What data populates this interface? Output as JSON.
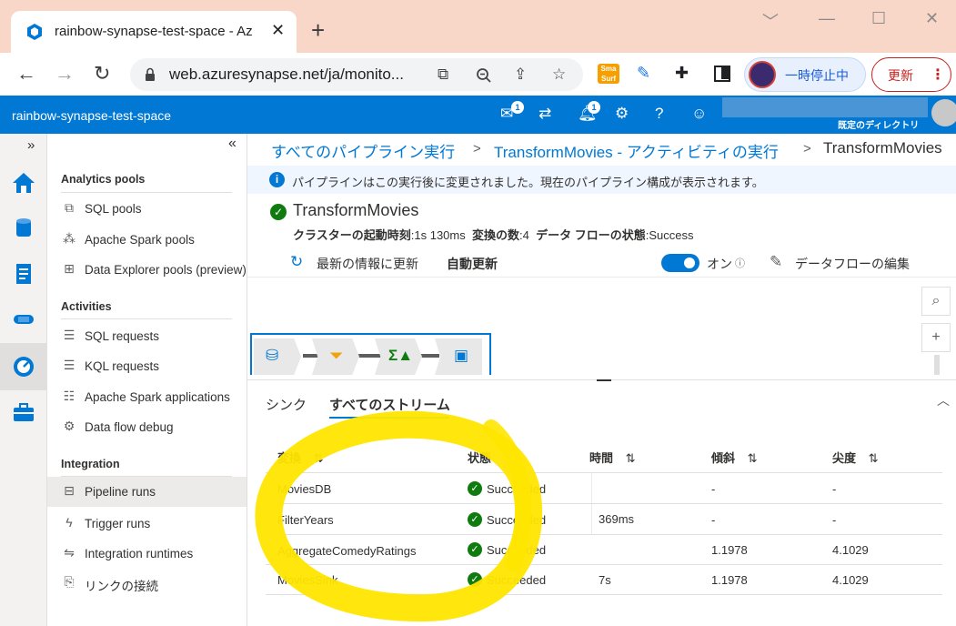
{
  "browser": {
    "tab_title": "rainbow-synapse-test-space - Az",
    "url": "web.azuresynapse.net/ja/monito...",
    "pause_label": "一時停止中",
    "update_label": "更新"
  },
  "header": {
    "workspace_name": "rainbow-synapse-test-space",
    "badge_feedback": "1",
    "badge_notifications": "1",
    "directory_label": "既定のディレクトリ"
  },
  "hub": {
    "sections": [
      {
        "title": "Analytics pools",
        "items": [
          "SQL pools",
          "Apache Spark pools",
          "Data Explorer pools (preview)"
        ]
      },
      {
        "title": "Activities",
        "items": [
          "SQL requests",
          "KQL requests",
          "Apache Spark applications",
          "Data flow debug"
        ]
      },
      {
        "title": "Integration",
        "items": [
          "Pipeline runs",
          "Trigger runs",
          "Integration runtimes",
          "リンクの接続"
        ]
      }
    ],
    "selected_item": "Pipeline runs"
  },
  "breadcrumb": {
    "items": [
      "すべてのパイプライン実行",
      "TransformMovies - アクティビティの実行"
    ],
    "current": "TransformMovies"
  },
  "info_message": "パイプラインはこの実行後に変更されました。現在のパイプライン構成が表示されます。",
  "run": {
    "title": "TransformMovies",
    "cluster_label": "クラスターの起動時刻",
    "cluster_value": "1s 130ms",
    "transform_label": "変換の数",
    "transform_value": "4",
    "flow_state_label": "データ フローの状態",
    "flow_state_value": "Success"
  },
  "toolbar": {
    "refresh_label": "最新の情報に更新",
    "auto_refresh_label": "自動更新",
    "toggle_label": "オン",
    "edit_label": "データフローの編集",
    "auto_refresh_on": true
  },
  "panel": {
    "tabs": [
      "シンク",
      "すべてのストリーム"
    ],
    "active_tab": "すべてのストリーム",
    "columns": [
      "変換",
      "状態",
      "時間",
      "傾斜",
      "尖度"
    ],
    "rows": [
      {
        "name": "MoviesDB",
        "status": "Succeeded",
        "time": "",
        "skew": "-",
        "kurtosis": "-"
      },
      {
        "name": "FilterYears",
        "status": "Succeeded",
        "time": "369ms",
        "skew": "-",
        "kurtosis": "-"
      },
      {
        "name": "AggregateComedyRatings",
        "status": "Succeeded",
        "time": "",
        "skew": "1.1978",
        "kurtosis": "4.1029"
      },
      {
        "name": "MoviesSink",
        "status": "Succeeded",
        "time": "7s",
        "skew": "1.1978",
        "kurtosis": "4.1029"
      }
    ]
  },
  "colors": {
    "azure_blue": "#0078d4",
    "success_green": "#107c10",
    "highlight_yellow": "#ffe600",
    "tabstrip": "#f9d7c8"
  }
}
